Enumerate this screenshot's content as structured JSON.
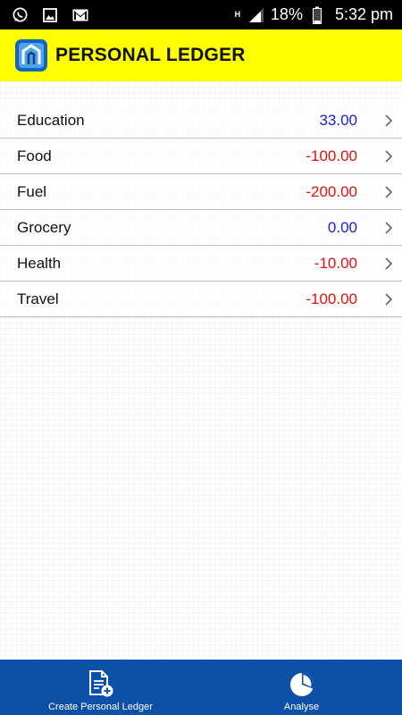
{
  "status_bar": {
    "network": "H",
    "battery_percent": "18%",
    "time": "5:32 pm",
    "icons": [
      "whatsapp-icon",
      "image-icon",
      "gmail-icon",
      "signal-icon",
      "battery-icon"
    ]
  },
  "app_bar": {
    "title": "PERSONAL LEDGER",
    "logo_icon": "ledger-logo-icon",
    "background_color": "#ffff00"
  },
  "ledgers": [
    {
      "name": "Education",
      "amount": "33.00",
      "color": "#1a1adc"
    },
    {
      "name": "Food",
      "amount": "-100.00",
      "color": "#e01010"
    },
    {
      "name": "Fuel",
      "amount": "-200.00",
      "color": "#e01010"
    },
    {
      "name": "Grocery",
      "amount": "0.00",
      "color": "#1a1adc"
    },
    {
      "name": "Health",
      "amount": "-10.00",
      "color": "#e01010"
    },
    {
      "name": "Travel",
      "amount": "-100.00",
      "color": "#e01010"
    }
  ],
  "bottom_nav": {
    "create_label": "Create Personal Ledger",
    "create_icon": "new-document-icon",
    "analyse_label": "Analyse",
    "analyse_icon": "pie-chart-icon",
    "background_color": "#0d50a8"
  }
}
